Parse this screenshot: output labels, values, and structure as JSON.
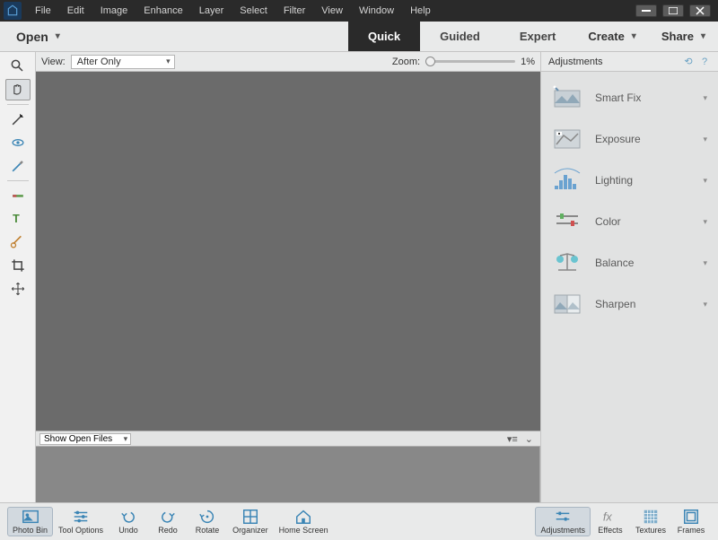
{
  "menu": [
    "File",
    "Edit",
    "Image",
    "Enhance",
    "Layer",
    "Select",
    "Filter",
    "View",
    "Window",
    "Help"
  ],
  "modebar": {
    "open_label": "Open",
    "tabs": [
      {
        "label": "Quick",
        "active": true
      },
      {
        "label": "Guided",
        "active": false
      },
      {
        "label": "Expert",
        "active": false
      }
    ],
    "create_label": "Create",
    "share_label": "Share"
  },
  "canvas_top": {
    "view_label": "View:",
    "view_value": "After Only",
    "zoom_label": "Zoom:",
    "zoom_value": "1%"
  },
  "bin": {
    "dropdown_value": "Show Open Files"
  },
  "adjustments": {
    "header": "Adjustments",
    "items": [
      {
        "name": "smart-fix",
        "label": "Smart Fix",
        "icon": "wand-photo"
      },
      {
        "name": "exposure",
        "label": "Exposure",
        "icon": "exposure"
      },
      {
        "name": "lighting",
        "label": "Lighting",
        "icon": "histogram"
      },
      {
        "name": "color",
        "label": "Color",
        "icon": "sliders"
      },
      {
        "name": "balance",
        "label": "Balance",
        "icon": "balance"
      },
      {
        "name": "sharpen",
        "label": "Sharpen",
        "icon": "split-photo"
      }
    ]
  },
  "bottombar_left": [
    {
      "name": "photo-bin",
      "label": "Photo Bin",
      "icon": "photo",
      "selected": true
    },
    {
      "name": "tool-options",
      "label": "Tool Options",
      "icon": "options",
      "selected": false
    },
    {
      "name": "undo",
      "label": "Undo",
      "icon": "undo",
      "selected": false
    },
    {
      "name": "redo",
      "label": "Redo",
      "icon": "redo",
      "selected": false
    },
    {
      "name": "rotate",
      "label": "Rotate",
      "icon": "rotate",
      "selected": false
    },
    {
      "name": "organizer",
      "label": "Organizer",
      "icon": "grid",
      "selected": false
    },
    {
      "name": "home-screen",
      "label": "Home Screen",
      "icon": "home",
      "selected": false
    }
  ],
  "bottombar_right": [
    {
      "name": "adjustments",
      "label": "Adjustments",
      "icon": "adjust",
      "selected": true
    },
    {
      "name": "effects",
      "label": "Effects",
      "icon": "fx",
      "selected": false
    },
    {
      "name": "textures",
      "label": "Textures",
      "icon": "texture",
      "selected": false
    },
    {
      "name": "frames",
      "label": "Frames",
      "icon": "frame",
      "selected": false
    }
  ],
  "tools": [
    {
      "name": "zoom",
      "icon": "magnifier",
      "selected": false
    },
    {
      "name": "hand",
      "icon": "hand",
      "selected": true
    },
    {
      "name": "--sep--"
    },
    {
      "name": "quick-select",
      "icon": "wand",
      "selected": false
    },
    {
      "name": "eye",
      "icon": "eye",
      "selected": false
    },
    {
      "name": "whiten",
      "icon": "brush",
      "selected": false
    },
    {
      "name": "--sep--"
    },
    {
      "name": "blemish",
      "icon": "blemish",
      "selected": false
    },
    {
      "name": "text",
      "icon": "text",
      "selected": false
    },
    {
      "name": "spot",
      "icon": "spot",
      "selected": false
    },
    {
      "name": "crop",
      "icon": "crop",
      "selected": false
    },
    {
      "name": "move",
      "icon": "move",
      "selected": false
    }
  ]
}
